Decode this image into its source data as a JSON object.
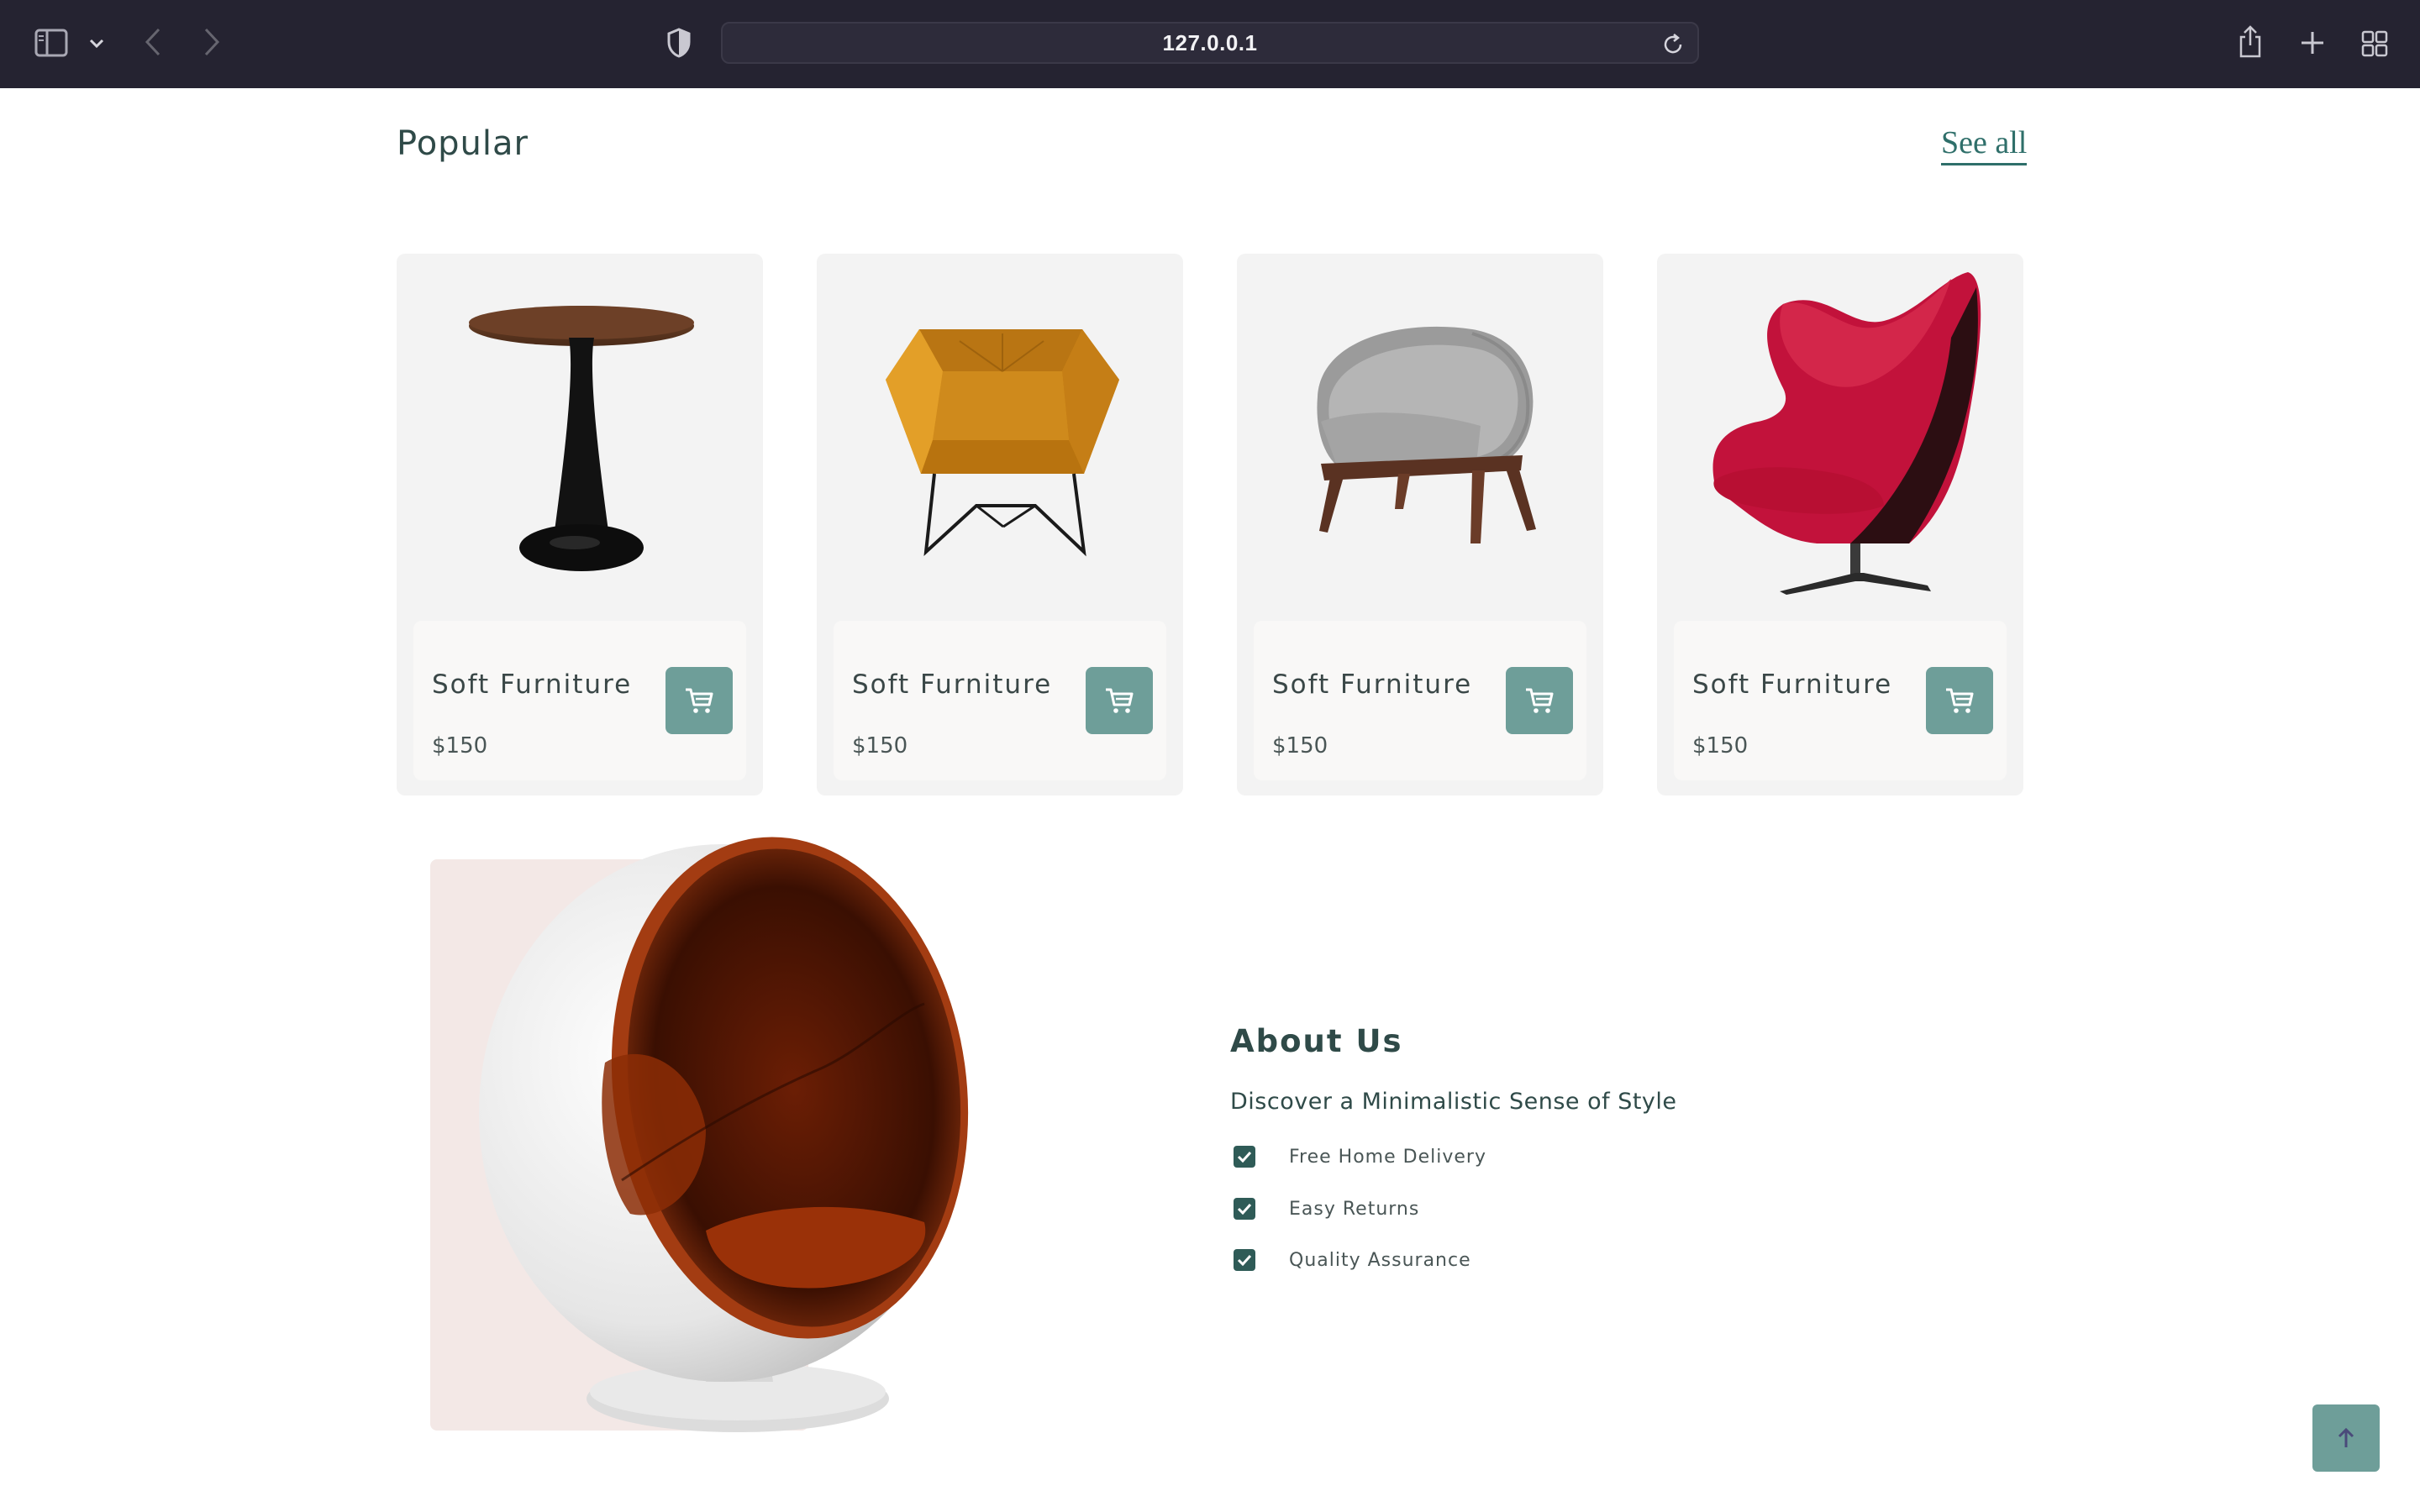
{
  "browser": {
    "url": "127.0.0.1"
  },
  "popular": {
    "title": "Popular",
    "see_all": "See all",
    "products": [
      {
        "name": "Soft Furniture",
        "price": "$150",
        "image": "round-side-table"
      },
      {
        "name": "Soft Furniture",
        "price": "$150",
        "image": "orange-armchair"
      },
      {
        "name": "Soft Furniture",
        "price": "$150",
        "image": "grey-lounge-chair"
      },
      {
        "name": "Soft Furniture",
        "price": "$150",
        "image": "red-egg-chair"
      }
    ]
  },
  "about": {
    "title": "About Us",
    "subtitle": "Discover a Minimalistic Sense of Style",
    "features": [
      "Free Home Delivery",
      "Easy Returns",
      "Quality Assurance"
    ],
    "image": "ball-chair"
  },
  "colors": {
    "accent": "#6e9e99",
    "heading": "#2f4a48",
    "card_bg": "#f3f3f3",
    "about_bg": "#f3e8e6"
  }
}
